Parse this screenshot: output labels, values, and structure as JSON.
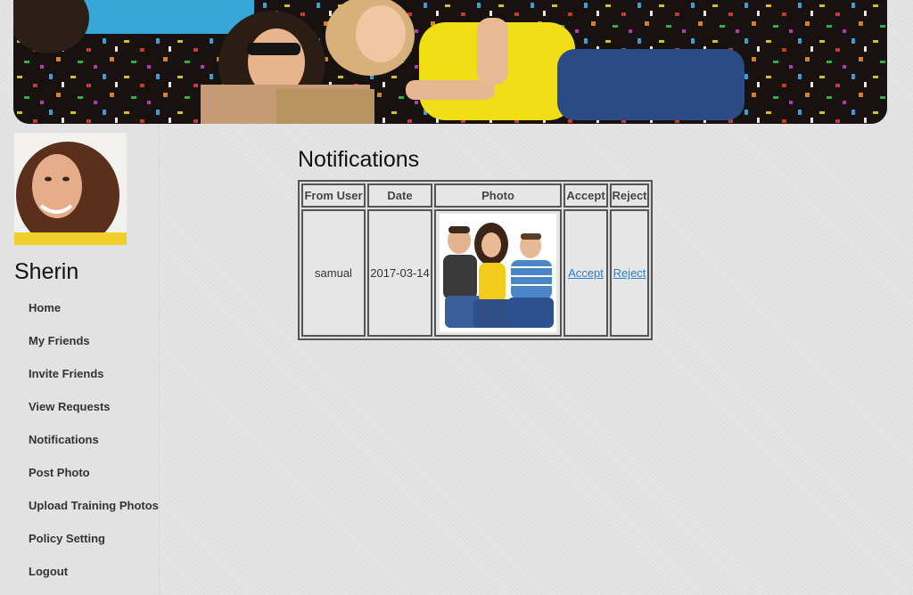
{
  "user": {
    "name": "Sherin"
  },
  "sidebar": {
    "items": [
      {
        "label": "Home"
      },
      {
        "label": "My Friends"
      },
      {
        "label": "Invite Friends"
      },
      {
        "label": "View Requests"
      },
      {
        "label": "Notifications"
      },
      {
        "label": "Post Photo"
      },
      {
        "label": "Upload Training Photos"
      },
      {
        "label": "Policy Setting"
      },
      {
        "label": "Logout"
      }
    ]
  },
  "main": {
    "title": "Notifications",
    "table": {
      "headers": [
        "From User",
        "Date",
        "Photo",
        "Accept",
        "Reject"
      ],
      "rows": [
        {
          "from_user": "samual",
          "date": "2017-03-14",
          "accept": "Accept",
          "reject": "Reject"
        }
      ]
    }
  }
}
